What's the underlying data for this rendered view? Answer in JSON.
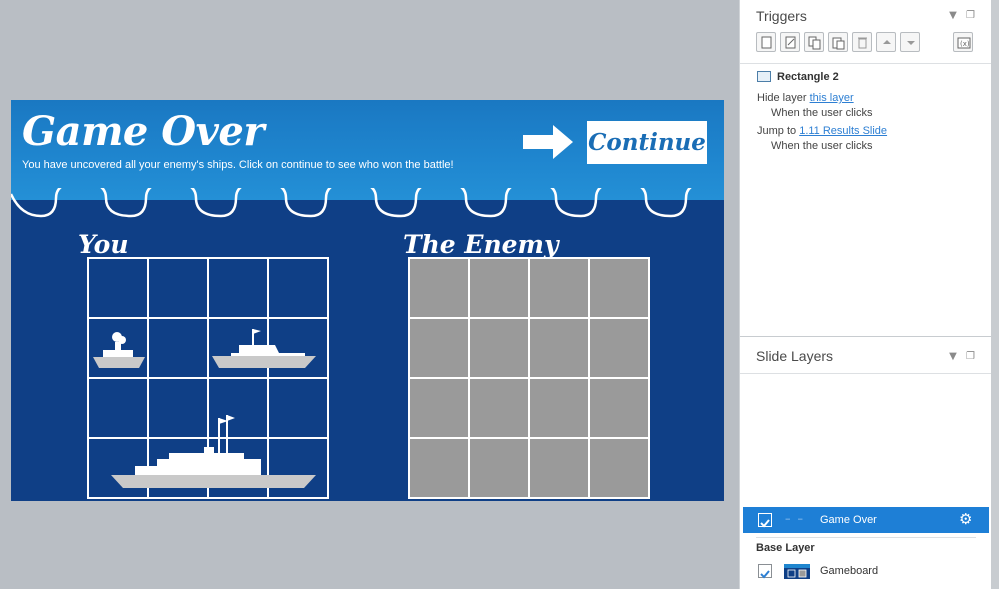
{
  "slide": {
    "title": "Game Over",
    "subtitle": "You have uncovered all your enemy's ships. Click on continue to see who won the battle!",
    "continue_label": "Continue",
    "you_label": "You",
    "enemy_label": "The Enemy",
    "colors": {
      "banner": "#1f86cf",
      "board_bg": "#0f3f86",
      "enemy_cell": "#9a9a9a",
      "continue_text": "#1a6db5"
    }
  },
  "triggers": {
    "title": "Triggers",
    "toolbar_icons": [
      "new-trigger-icon",
      "edit-trigger-icon",
      "copy-trigger-icon",
      "paste-trigger-icon",
      "delete-trigger-icon",
      "move-up-icon",
      "move-down-icon",
      "variables-icon"
    ],
    "object_name": "Rectangle 2",
    "items": [
      {
        "action": "Hide layer",
        "target": "this layer",
        "condition": "When the user clicks"
      },
      {
        "action": "Jump to",
        "target": "1.11 Results Slide",
        "condition": "When the user clicks"
      }
    ]
  },
  "layers": {
    "title": "Slide Layers",
    "active_layer": {
      "name": "Game Over",
      "checked": true
    },
    "base_label": "Base Layer",
    "base_layer": {
      "name": "Gameboard",
      "checked": true
    }
  }
}
